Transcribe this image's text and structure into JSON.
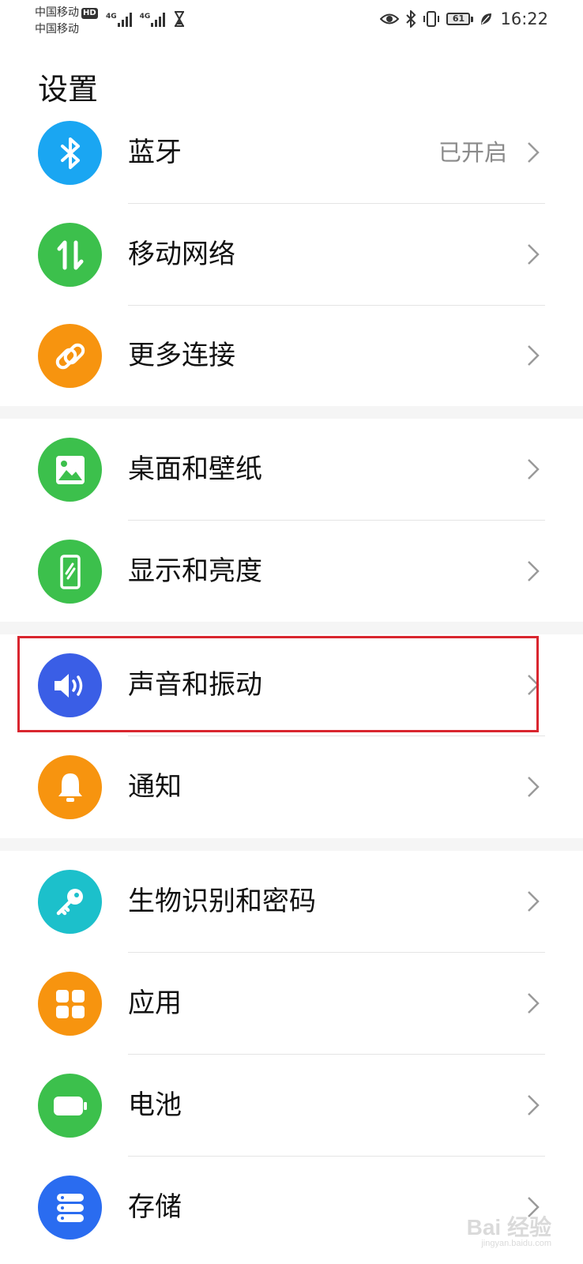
{
  "status_bar": {
    "carrier_1": "中国移动",
    "carrier_1_badge": "HD",
    "carrier_2": "中国移动",
    "network_1": "4G",
    "network_2": "4G",
    "battery_level": "61",
    "time": "16:22"
  },
  "page": {
    "title": "设置"
  },
  "items": [
    {
      "label": "蓝牙",
      "value": "已开启",
      "icon": "bluetooth-icon",
      "color": "#1aa6f2"
    },
    {
      "label": "移动网络",
      "icon": "mobile-data-icon",
      "color": "#3cc04c"
    },
    {
      "label": "更多连接",
      "icon": "link-icon",
      "color": "#f7940f"
    },
    {
      "label": "桌面和壁纸",
      "icon": "image-icon",
      "color": "#3cc04c"
    },
    {
      "label": "显示和亮度",
      "icon": "phone-display-icon",
      "color": "#3cc04c"
    },
    {
      "label": "声音和振动",
      "icon": "speaker-icon",
      "color": "#3a5ee6",
      "highlighted": true
    },
    {
      "label": "通知",
      "icon": "bell-icon",
      "color": "#f7940f"
    },
    {
      "label": "生物识别和密码",
      "icon": "key-icon",
      "color": "#1cc0cb"
    },
    {
      "label": "应用",
      "icon": "apps-grid-icon",
      "color": "#f7940f"
    },
    {
      "label": "电池",
      "icon": "battery-icon",
      "color": "#3cc04c"
    },
    {
      "label": "存储",
      "icon": "storage-icon",
      "color": "#2a6cf0"
    }
  ],
  "watermark": {
    "text": "Bai 经验",
    "sub": "jingyan.baidu.com"
  }
}
